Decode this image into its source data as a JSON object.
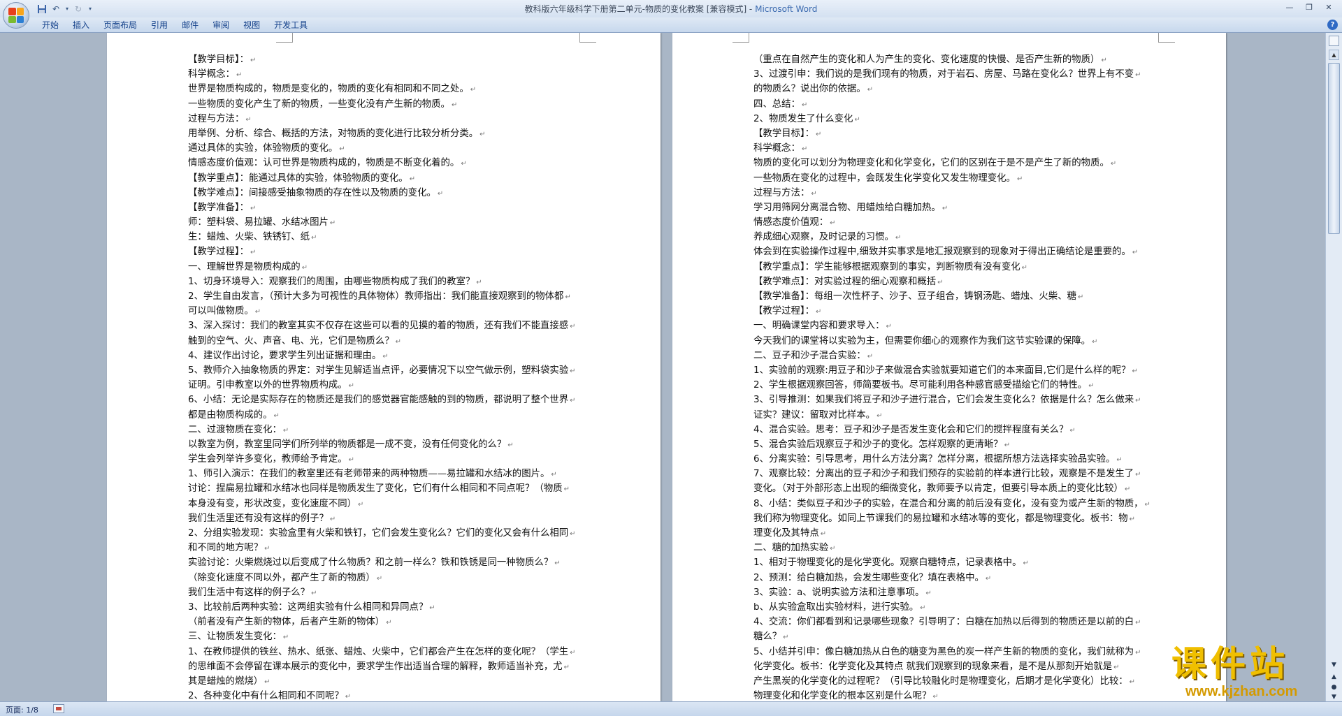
{
  "window": {
    "title": "教科版六年级科学下册第二单元-物质的变化教案 [兼容模式] - ",
    "app_name": "Microsoft Word",
    "controls": [
      "minimize",
      "restore",
      "close"
    ]
  },
  "quick_access": {
    "icons": [
      "save-icon",
      "undo-icon",
      "redo-icon",
      "customize-icon"
    ]
  },
  "ribbon": {
    "tabs": [
      "开始",
      "插入",
      "页面布局",
      "引用",
      "邮件",
      "审阅",
      "视图",
      "开发工具"
    ]
  },
  "pages": {
    "left": [
      "【教学目标】：",
      "科学概念：",
      "世界是物质构成的，物质是变化的，物质的变化有相同和不同之处。",
      "一些物质的变化产生了新的物质，一些变化没有产生新的物质。",
      "过程与方法：",
      "用举例、分析、综合、概括的方法，对物质的变化进行比较分析分类。",
      "通过具体的实验，体验物质的变化。",
      "情感态度价值观：认可世界是物质构成的，物质是不断变化着的。",
      "【教学重点】：能通过具体的实验，体验物质的变化。",
      "【教学难点】：间接感受抽象物质的存在性以及物质的变化。",
      "【教学准备】：",
      "师：塑料袋、易拉罐、水结冰图片",
      "生：蜡烛、火柴、铁锈钉、纸",
      "【教学过程】：",
      "一、理解世界是物质构成的",
      "1、切身环境导入：观察我们的周围，由哪些物质构成了我们的教室？",
      "2、学生自由发言，（预计大多为可视性的具体物体）教师指出：我们能直接观察到的物体都",
      "可以叫做物质。",
      "3、深入探讨：我们的教室其实不仅存在这些可以看的见摸的着的物质，还有我们不能直接感",
      "触到的空气、火、声音、电、光，它们是物质么？",
      "4、建议作出讨论，要求学生列出证据和理由。",
      "5、教师介入抽象物质的界定：对学生见解适当点评，必要情况下以空气做示例，塑料袋实验",
      "证明。引申教室以外的世界物质构成。",
      "6、小结：无论是实际存在的物质还是我们的感觉器官能感触的到的物质，都说明了整个世界",
      "都是由物质构成的。",
      "二、过渡物质在变化：",
      "以教室为例，教室里同学们所列举的物质都是一成不变，没有任何变化的么？",
      "学生会列举许多变化，教师给予肯定。",
      "1、师引入演示：在我们的教室里还有老师带来的两种物质——易拉罐和水结冰的图片。",
      "讨论：捏扁易拉罐和水结冰也同样是物质发生了变化，它们有什么相同和不同点呢？（物质",
      "本身没有变，形状改变，变化速度不同）",
      "我们生活里还有没有这样的例子？",
      "2、分组实验发现：实验盒里有火柴和铁钉，它们会发生变化么？它们的变化又会有什么相同",
      "和不同的地方呢？",
      "  实验讨论：火柴燃烧过以后变成了什么物质？和之前一样么？铁和铁锈是同一种物质么？",
      "（除变化速度不同以外，都产生了新的物质）",
      "  我们生活中有这样的例子么？",
      "3、比较前后两种实验：这两组实验有什么相同和异同点？",
      "（前者没有产生新的物体，后者产生新的物体）",
      "三、让物质发生变化：",
      "1、在教师提供的铁丝、热水、纸张、蜡烛、火柴中，它们都会产生在怎样的变化呢？（学生",
      "的思维面不会停留在课本展示的变化中，要求学生作出适当合理的解释，教师适当补充，尤",
      "其是蜡烛的燃烧）",
      "2、各种变化中有什么相同和不同呢？"
    ],
    "right": [
      "（重点在自然产生的变化和人为产生的变化、变化速度的快慢、是否产生新的物质）",
      "3、过渡引申：我们说的是我们现有的物质，对于岩石、房屋、马路在变化么？世界上有不变",
      "的物质么？说出你的依据。",
      "四、总结：",
      "2、物质发生了什么变化",
      "【教学目标】：",
      "科学概念：",
      "物质的变化可以划分为物理变化和化学变化，它们的区别在于是不是产生了新的物质。",
      "一些物质在变化的过程中，会既发生化学变化又发生物理变化。",
      "过程与方法：",
      "学习用筛网分离混合物、用蜡烛给白糖加热。",
      "情感态度价值观：",
      "养成细心观察，及时记录的习惯。",
      "体会到在实验操作过程中,细致并实事求是地汇报观察到的现象对于得出正确结论是重要的。",
      "【教学重点】：学生能够根据观察到的事实，判断物质有没有变化",
      "【教学难点】：对实验过程的细心观察和概括",
      "【教学准备】：每组一次性杯子、沙子、豆子组合，铸钢汤匙、蜡烛、火柴、糖",
      "【教学过程】：",
      "一、明确课堂内容和要求导入：",
      "今天我们的课堂将以实验为主，但需要你细心的观察作为我们这节实验课的保障。",
      "二、豆子和沙子混合实验：",
      "1、实验前的观察:用豆子和沙子来做混合实验就要知道它们的本来面目,它们是什么样的呢？",
      "2、学生根据观察回答，师简要板书。尽可能利用各种感官感受描绘它们的特性。",
      "3、引导推测：如果我们将豆子和沙子进行混合，它们会发生变化么？依据是什么？怎么做来",
      "证实？建议：留取对比样本。",
      "4、混合实验。思考：豆子和沙子是否发生变化会和它们的搅拌程度有关么？",
      "5、混合实验后观察豆子和沙子的变化。怎样观察的更清晰？",
      "6、分离实验：引导思考，用什么方法分离？怎样分离，根据所想方法选择实验品实验。",
      "7、观察比较：分离出的豆子和沙子和我们预存的实验前的样本进行比较，观察是不是发生了",
      "变化。（对于外部形态上出现的细微变化，教师要予以肯定，但要引导本质上的变化比较）",
      "8、小结：类似豆子和沙子的实验，在混合和分离的前后没有变化，没有变为或产生新的物质，",
      "我们称为物理变化。如同上节课我们的易拉罐和水结冰等的变化，都是物理变化。板书：物",
      "理变化及其特点",
      "二、糖的加热实验",
      "1、相对于物理变化的是化学变化。观察白糖特点，记录表格中。",
      "2、预测：给白糖加热，会发生哪些变化？填在表格中。",
      "3、实验：a、说明实验方法和注意事项。",
      "b、从实验盒取出实验材料，进行实验。",
      "4、交流：你们都看到和记录哪些现象？引导明了：白糖在加热以后得到的物质还是以前的白",
      "糖么？",
      "5、小结并引申：像白糖加热从白色的糖变为黑色的炭一样产生新的物质的变化，我们就称为",
      "化学变化。板书：化学变化及其特点 就我们观察到的现象来看，是不是从那刻开始就是",
      "产生黑炭的化学变化的过程呢？（引导比较融化时是物理变化，后期才是化学变化）比较：",
      "物理变化和化学变化的根本区别是什么呢？"
    ]
  },
  "statusbar": {
    "page_info": "页面: 1/8"
  },
  "watermark": {
    "brand": "课件站",
    "url": "www.kjzhan.com"
  },
  "colors": {
    "office_logo": [
      "#e8401c",
      "#f9a51b",
      "#7bbb2f",
      "#2b7fd4"
    ],
    "title_accent": "#3c6bb0",
    "watermark": "#f0bf00"
  }
}
